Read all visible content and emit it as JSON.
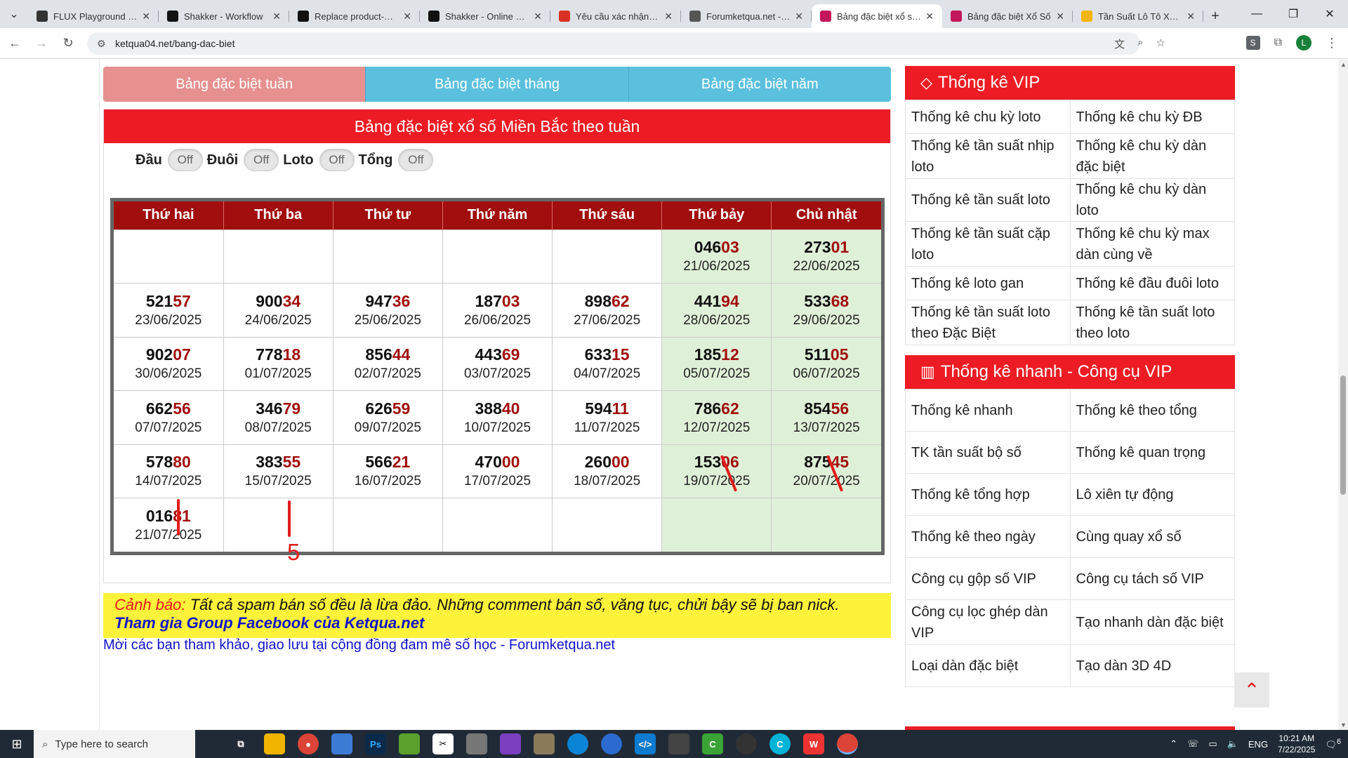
{
  "browser": {
    "tabs": [
      {
        "title": "FLUX Playground - Bl",
        "color": "#333333"
      },
      {
        "title": "Shakker - Workflow",
        "color": "#111111"
      },
      {
        "title": "Replace product-Wor",
        "color": "#111111"
      },
      {
        "title": "Shakker - Online Com",
        "color": "#111111"
      },
      {
        "title": "Yêu cầu xác nhận tài k",
        "color": "#d93025"
      },
      {
        "title": "Forumketqua.net - Di",
        "color": "#555555"
      },
      {
        "title": "Bảng đặc biệt xổ số M",
        "color": "#c2185b",
        "active": true
      },
      {
        "title": "Bảng đặc biệt Xổ Số",
        "color": "#c2185b"
      },
      {
        "title": "Tần Suất Lô Tô XSMB",
        "color": "#f4b400"
      }
    ],
    "url": "ketqua04.net/bang-dac-biet"
  },
  "segtabs": [
    "Bảng đặc biệt tuần",
    "Bảng đặc biệt tháng",
    "Bảng đặc biệt năm"
  ],
  "panel": {
    "title": "Bảng đặc biệt xổ số Miền Bắc theo tuần",
    "toggles": [
      {
        "label": "Đầu",
        "state": "Off"
      },
      {
        "label": "Đuôi",
        "state": "Off"
      },
      {
        "label": "Loto",
        "state": "Off"
      },
      {
        "label": "Tổng",
        "state": "Off"
      }
    ]
  },
  "calendar": {
    "days": [
      "Thứ hai",
      "Thứ ba",
      "Thứ tư",
      "Thứ năm",
      "Thứ sáu",
      "Thứ bảy",
      "Chủ nhật"
    ],
    "rows": [
      [
        null,
        null,
        null,
        null,
        null,
        {
          "head": "046",
          "tail": "03",
          "date": "21/06/2025"
        },
        {
          "head": "273",
          "tail": "01",
          "date": "22/06/2025"
        }
      ],
      [
        {
          "head": "521",
          "tail": "57",
          "date": "23/06/2025"
        },
        {
          "head": "900",
          "tail": "34",
          "date": "24/06/2025"
        },
        {
          "head": "947",
          "tail": "36",
          "date": "25/06/2025"
        },
        {
          "head": "187",
          "tail": "03",
          "date": "26/06/2025"
        },
        {
          "head": "898",
          "tail": "62",
          "date": "27/06/2025"
        },
        {
          "head": "441",
          "tail": "94",
          "date": "28/06/2025"
        },
        {
          "head": "533",
          "tail": "68",
          "date": "29/06/2025"
        }
      ],
      [
        {
          "head": "902",
          "tail": "07",
          "date": "30/06/2025"
        },
        {
          "head": "778",
          "tail": "18",
          "date": "01/07/2025"
        },
        {
          "head": "856",
          "tail": "44",
          "date": "02/07/2025"
        },
        {
          "head": "443",
          "tail": "69",
          "date": "03/07/2025"
        },
        {
          "head": "633",
          "tail": "15",
          "date": "04/07/2025"
        },
        {
          "head": "185",
          "tail": "12",
          "date": "05/07/2025"
        },
        {
          "head": "511",
          "tail": "05",
          "date": "06/07/2025"
        }
      ],
      [
        {
          "head": "662",
          "tail": "56",
          "date": "07/07/2025"
        },
        {
          "head": "346",
          "tail": "79",
          "date": "08/07/2025"
        },
        {
          "head": "626",
          "tail": "59",
          "date": "09/07/2025"
        },
        {
          "head": "388",
          "tail": "40",
          "date": "10/07/2025"
        },
        {
          "head": "594",
          "tail": "11",
          "date": "11/07/2025"
        },
        {
          "head": "786",
          "tail": "62",
          "date": "12/07/2025"
        },
        {
          "head": "854",
          "tail": "56",
          "date": "13/07/2025"
        }
      ],
      [
        {
          "head": "578",
          "tail": "80",
          "date": "14/07/2025"
        },
        {
          "head": "383",
          "tail": "55",
          "date": "15/07/2025"
        },
        {
          "head": "566",
          "tail": "21",
          "date": "16/07/2025"
        },
        {
          "head": "470",
          "tail": "00",
          "date": "17/07/2025"
        },
        {
          "head": "260",
          "tail": "00",
          "date": "18/07/2025"
        },
        {
          "head": "153",
          "tail": "06",
          "date": "19/07/2025"
        },
        {
          "head": "875",
          "tail": "45",
          "date": "20/07/2025"
        }
      ],
      [
        {
          "head": "016",
          "tail": "81",
          "date": "21/07/2025"
        },
        null,
        null,
        null,
        null,
        null,
        null
      ]
    ],
    "annotation_number": "5"
  },
  "warning": {
    "label": "Cảnh báo:",
    "text": " Tất cả spam bán số đều là lừa đảo. Những comment bán số, văng tục, chửi bậy sẽ bị ban nick.",
    "group_link": "Tham gia Group Facebook của Ketqua.net",
    "invite": "Mời các bạn tham khảo, giao lưu tại cộng đồng đam mê số học - Forumketqua.net"
  },
  "sidebar": {
    "vip_title": "Thống kê VIP",
    "vip_items": [
      [
        "Thống kê chu kỳ loto",
        "Thống kê chu kỳ ĐB"
      ],
      [
        "Thống kê tần suất nhịp loto",
        "Thống kê chu kỳ dàn đặc biệt"
      ],
      [
        "Thống kê tần suất loto",
        "Thống kê chu kỳ dàn loto"
      ],
      [
        "Thống kê tần suất cặp loto",
        "Thống kê chu kỳ max dàn cùng về"
      ],
      [
        "Thống kê loto gan",
        "Thống kê đầu đuôi loto"
      ],
      [
        "Thống kê tần suất loto theo Đặc Biệt",
        "Thống kê tần suất loto theo loto"
      ]
    ],
    "quick_title": "Thống kê nhanh - Công cụ VIP",
    "quick_items": [
      [
        "Thống kê nhanh",
        "Thống kê theo tổng"
      ],
      [
        "TK tần suất bộ số",
        "Thống kê quan trọng"
      ],
      [
        "Thống kê tổng hợp",
        "Lô xiên tự động"
      ],
      [
        "Thống kê theo ngày",
        "Cùng quay xổ số"
      ],
      [
        "Công cụ gộp số VIP",
        "Công cụ tách số VIP"
      ],
      [
        "Công cụ lọc ghép dàn VIP",
        "Tạo nhanh dàn đặc biệt"
      ],
      [
        "Loại dàn đặc biệt",
        "Tạo dàn 3D 4D"
      ]
    ]
  },
  "taskbar": {
    "search_placeholder": "Type here to search",
    "lang": "ENG",
    "time": "10:21 AM",
    "date": "7/22/2025",
    "notif_count": "6"
  }
}
